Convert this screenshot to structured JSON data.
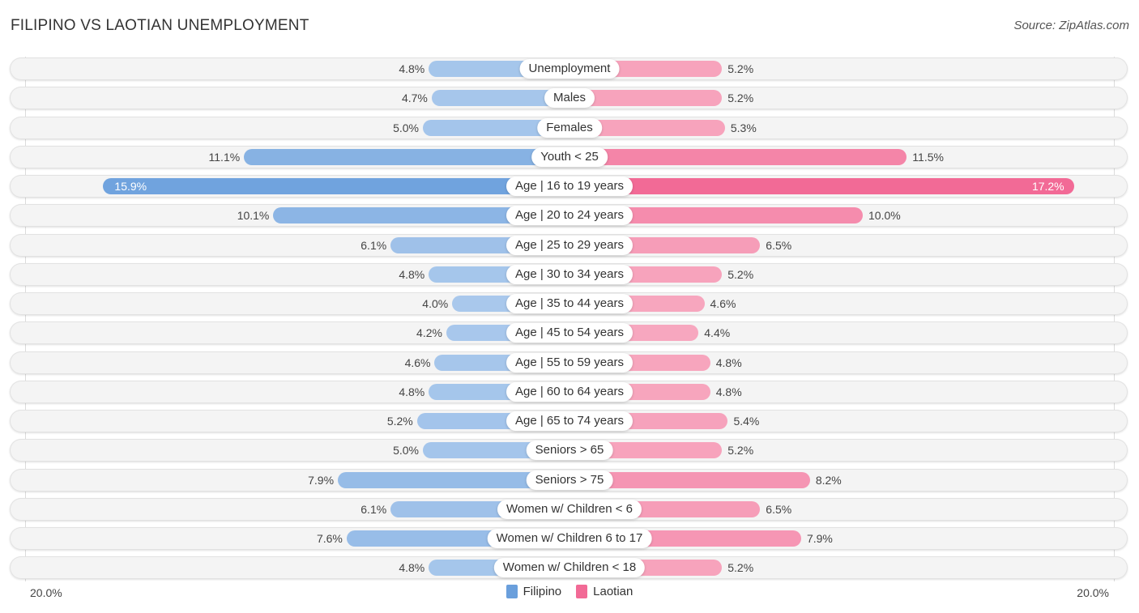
{
  "header": {
    "title": "FILIPINO VS LAOTIAN UNEMPLOYMENT",
    "source": "Source: ZipAtlas.com"
  },
  "colors": {
    "filipino": "#6a9fdc",
    "filipino_light": "#a9c8ec",
    "laotian": "#f26a96",
    "laotian_light": "#f7a9c0"
  },
  "chart_data": {
    "type": "bar",
    "orientation": "horizontal-diverging",
    "title": "FILIPINO VS LAOTIAN UNEMPLOYMENT",
    "xlabel": "",
    "ylabel": "",
    "xlim": [
      -20,
      20
    ],
    "axis_min_label": "20.0%",
    "axis_max_label": "20.0%",
    "legend_position": "bottom-center",
    "categories": [
      "Unemployment",
      "Males",
      "Females",
      "Youth < 25",
      "Age | 16 to 19 years",
      "Age | 20 to 24 years",
      "Age | 25 to 29 years",
      "Age | 30 to 34 years",
      "Age | 35 to 44 years",
      "Age | 45 to 54 years",
      "Age | 55 to 59 years",
      "Age | 60 to 64 years",
      "Age | 65 to 74 years",
      "Seniors > 65",
      "Seniors > 75",
      "Women w/ Children < 6",
      "Women w/ Children 6 to 17",
      "Women w/ Children < 18"
    ],
    "series": [
      {
        "name": "Filipino",
        "side": "left",
        "values": [
          4.8,
          4.7,
          5.0,
          11.1,
          15.9,
          10.1,
          6.1,
          4.8,
          4.0,
          4.2,
          4.6,
          4.8,
          5.2,
          5.0,
          7.9,
          6.1,
          7.6,
          4.8
        ],
        "labels": [
          "4.8%",
          "4.7%",
          "5.0%",
          "11.1%",
          "15.9%",
          "10.1%",
          "6.1%",
          "4.8%",
          "4.0%",
          "4.2%",
          "4.6%",
          "4.8%",
          "5.2%",
          "5.0%",
          "7.9%",
          "6.1%",
          "7.6%",
          "4.8%"
        ]
      },
      {
        "name": "Laotian",
        "side": "right",
        "values": [
          5.2,
          5.2,
          5.3,
          11.5,
          17.2,
          10.0,
          6.5,
          5.2,
          4.6,
          4.4,
          4.8,
          4.8,
          5.4,
          5.2,
          8.2,
          6.5,
          7.9,
          5.2
        ],
        "labels": [
          "5.2%",
          "5.2%",
          "5.3%",
          "11.5%",
          "17.2%",
          "10.0%",
          "6.5%",
          "5.2%",
          "4.6%",
          "4.4%",
          "4.8%",
          "4.8%",
          "5.4%",
          "5.2%",
          "8.2%",
          "6.5%",
          "7.9%",
          "5.2%"
        ]
      }
    ]
  },
  "legend": {
    "items": [
      {
        "label": "Filipino",
        "color": "#6a9fdc"
      },
      {
        "label": "Laotian",
        "color": "#f26a96"
      }
    ]
  }
}
